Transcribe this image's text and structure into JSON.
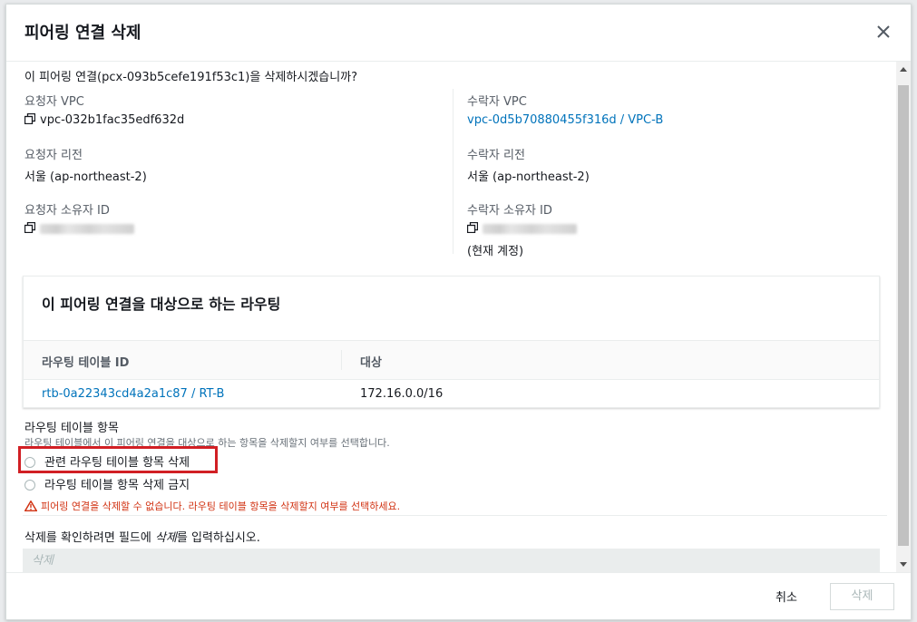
{
  "dialog": {
    "title": "피어링 연결 삭제",
    "confirm_question": "이 피어링 연결(pcx-093b5cefe191f53c1)을 삭제하시겠습니까?"
  },
  "requester": {
    "vpc_label": "요청자 VPC",
    "vpc_value": "vpc-032b1fac35edf632d",
    "region_label": "요청자 리전",
    "region_value": "서울 (ap-northeast-2)",
    "owner_label": "요청자 소유자 ID"
  },
  "accepter": {
    "vpc_label": "수락자 VPC",
    "vpc_value": "vpc-0d5b70880455f316d / VPC-B",
    "region_label": "수락자 리전",
    "region_value": "서울 (ap-northeast-2)",
    "owner_label": "수락자 소유자 ID",
    "owner_note": "(현재 계정)"
  },
  "routes": {
    "title": "이 피어링 연결을 대상으로 하는 라우팅",
    "columns": [
      "라우팅 테이블 ID",
      "대상"
    ],
    "rows": [
      {
        "table_id": "rtb-0a22343cd4a2a1c87 / RT-B",
        "destination": "172.16.0.0/16"
      }
    ]
  },
  "route_entries": {
    "label": "라우팅 테이블 항목",
    "description": "라우팅 테이블에서 이 피어링 연결을 대상으로 하는 항목을 삭제할지 여부를 선택합니다.",
    "options": [
      "관련 라우팅 테이블 항목 삭제",
      "라우팅 테이블 항목 삭제 금지"
    ],
    "warning": "피어링 연결을 삭제할 수 없습니다. 라우팅 테이블 항목을 삭제할지 여부를 선택하세요."
  },
  "confirm_input": {
    "label_before": "삭제를 확인하려면 필드에 ",
    "label_word": "삭제",
    "label_after": "를 입력하십시오.",
    "placeholder": "삭제"
  },
  "footer": {
    "cancel_label": "취소",
    "delete_label": "삭제"
  },
  "colors": {
    "link": "#0073bb",
    "warning": "#d13212",
    "highlight": "#d11f24"
  }
}
